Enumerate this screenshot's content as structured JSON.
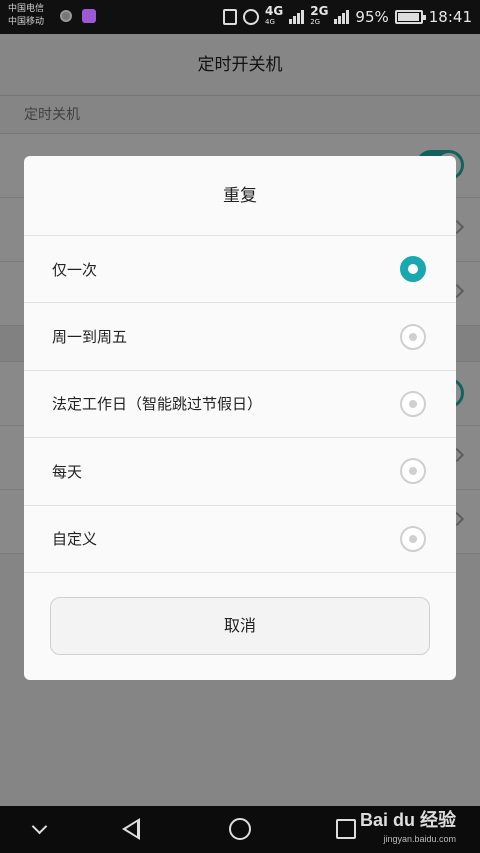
{
  "status_bar": {
    "carrier_1": "中国电信",
    "carrier_2": "中国移动",
    "network_4g": "4G",
    "network_4g_sub": "4G",
    "network_2g": "2G",
    "network_2g_sub": "2G",
    "battery_percent": "95%",
    "time": "18:41",
    "icons": [
      "vibrate-icon",
      "alarm-icon",
      "signal-icon",
      "battery-icon"
    ]
  },
  "background_page": {
    "title": "定时开关机",
    "section_label": "定时关机",
    "toggle_on_color": "#20b2aa"
  },
  "dialog": {
    "title": "重复",
    "options": [
      {
        "label": "仅一次",
        "selected": true
      },
      {
        "label": "周一到周五",
        "selected": false
      },
      {
        "label": "法定工作日（智能跳过节假日）",
        "selected": false
      },
      {
        "label": "每天",
        "selected": false
      },
      {
        "label": "自定义",
        "selected": false
      }
    ],
    "cancel_label": "取消",
    "accent_color": "#1aa8b0"
  },
  "nav_bar": {
    "watermark_main": "Bai du 经验",
    "watermark_sub": "jingyan.baidu.com"
  }
}
